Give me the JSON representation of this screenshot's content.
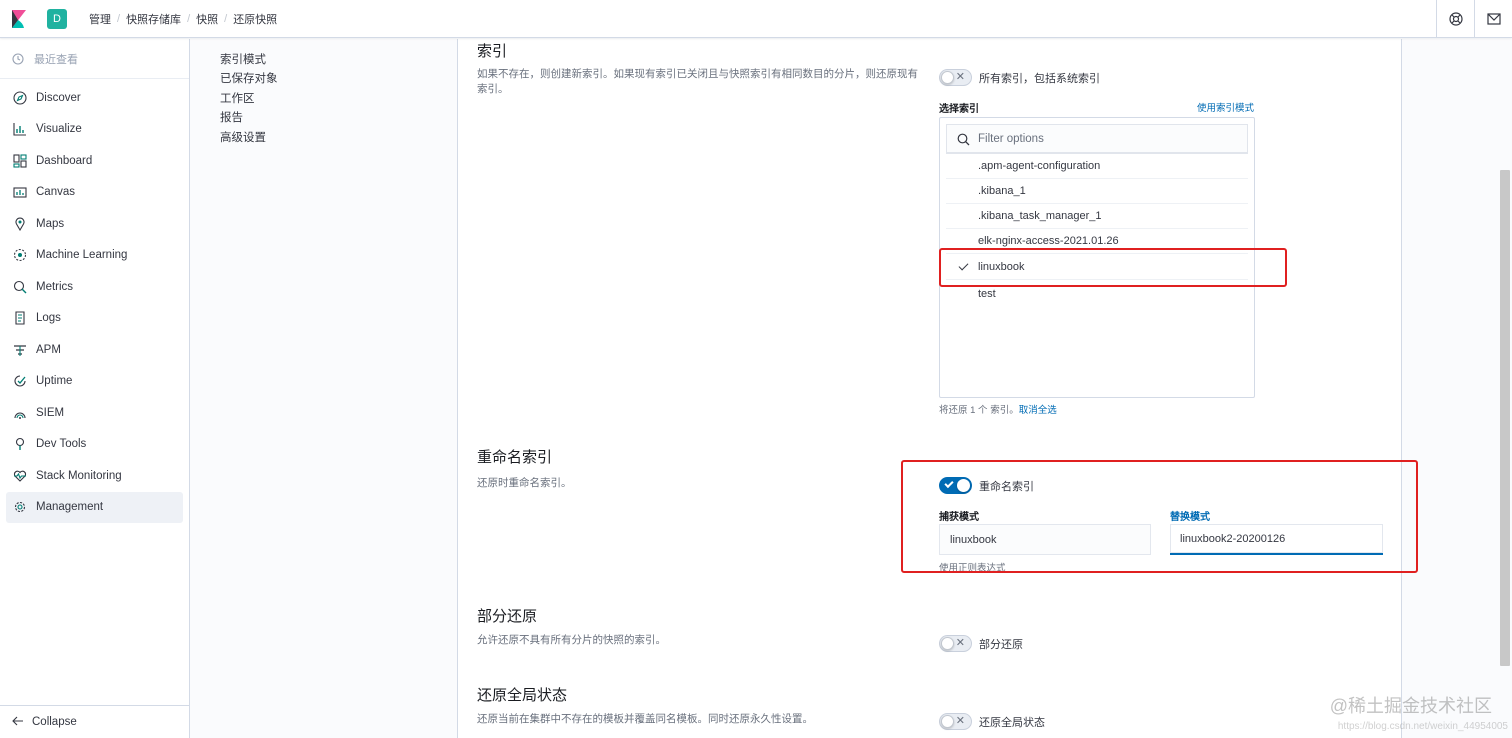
{
  "header": {
    "space_initial": "D",
    "breadcrumbs": [
      "管理",
      "快照存储库",
      "快照",
      "还原快照"
    ]
  },
  "leftnav": {
    "recent_label": "最近查看",
    "items": [
      {
        "label": "Discover",
        "icon": "compass-icon"
      },
      {
        "label": "Visualize",
        "icon": "chart-icon"
      },
      {
        "label": "Dashboard",
        "icon": "dashboard-icon"
      },
      {
        "label": "Canvas",
        "icon": "canvas-icon"
      },
      {
        "label": "Maps",
        "icon": "map-pin-icon"
      },
      {
        "label": "Machine Learning",
        "icon": "ml-icon"
      },
      {
        "label": "Metrics",
        "icon": "metrics-icon"
      },
      {
        "label": "Logs",
        "icon": "logs-icon"
      },
      {
        "label": "APM",
        "icon": "apm-icon"
      },
      {
        "label": "Uptime",
        "icon": "uptime-icon"
      },
      {
        "label": "SIEM",
        "icon": "siem-icon"
      },
      {
        "label": "Dev Tools",
        "icon": "wrench-icon"
      },
      {
        "label": "Stack Monitoring",
        "icon": "heartbeat-icon"
      },
      {
        "label": "Management",
        "icon": "gear-icon"
      }
    ],
    "active": "Management",
    "collapse_label": "Collapse"
  },
  "subnav": {
    "items": [
      "索引模式",
      "已保存对象",
      "工作区",
      "报告",
      "高级设置"
    ]
  },
  "index_section": {
    "title": "索引",
    "description": "如果不存在，则创建新索引。如果现有索引已关闭且与快照索引有相同数目的分片，则还原现有索引。",
    "all_indices_toggle": "所有索引，包括系统索引",
    "select_label": "选择索引",
    "use_pattern_link": "使用索引模式",
    "filter_placeholder": "Filter options",
    "options": [
      {
        "label": ".apm-agent-configuration",
        "checked": false
      },
      {
        "label": ".kibana_1",
        "checked": false
      },
      {
        "label": ".kibana_task_manager_1",
        "checked": false
      },
      {
        "label": "elk-nginx-access-2021.01.26",
        "checked": false
      },
      {
        "label": "linuxbook",
        "checked": true
      },
      {
        "label": "test",
        "checked": false
      }
    ],
    "restore_count_text": "将还原 1 个 索引。",
    "deselect_all": "取消全选"
  },
  "rename_section": {
    "title": "重命名索引",
    "description": "还原时重命名索引。",
    "toggle_label": "重命名索引",
    "toggle_on": true,
    "capture_label": "捕获模式",
    "capture_value": "linuxbook",
    "replace_label": "替换模式",
    "replace_value": "linuxbook2-20200126",
    "regex_link": "使用正则表达式"
  },
  "partial_section": {
    "title": "部分还原",
    "description": "允许还原不具有所有分片的快照的索引。",
    "toggle_label": "部分还原"
  },
  "global_section": {
    "title": "还原全局状态",
    "description": "还原当前在集群中不存在的模板并覆盖同名模板。同时还原永久性设置。",
    "toggle_label": "还原全局状态"
  },
  "watermark": {
    "main": "@稀土掘金技术社区",
    "sub": "https://blog.csdn.net/weixin_44954005"
  },
  "colors": {
    "accent": "#006bb4",
    "highlight_box": "#e02020",
    "space_avatar": "#20b2a0"
  }
}
